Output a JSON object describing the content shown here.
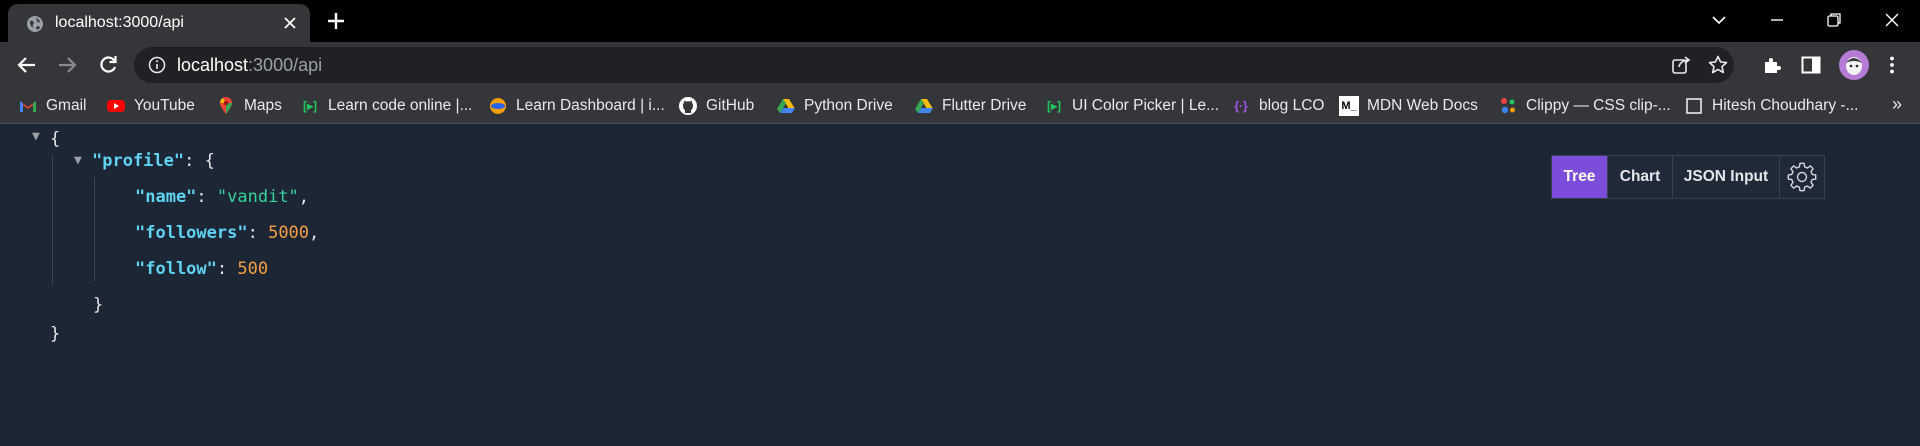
{
  "tab": {
    "title": "localhost:3000/api",
    "favicon": "globe-icon"
  },
  "address_bar": {
    "host": "localhost",
    "path": ":3000/api"
  },
  "bookmarks": [
    {
      "label": "Gmail",
      "icon": "gmail-icon"
    },
    {
      "label": "YouTube",
      "icon": "youtube-icon"
    },
    {
      "label": "Maps",
      "icon": "maps-pin-icon"
    },
    {
      "label": "Learn code online |...",
      "icon": "code-brackets-icon"
    },
    {
      "label": "Learn Dashboard | i...",
      "icon": "dashboard-icon"
    },
    {
      "label": "GitHub",
      "icon": "github-icon"
    },
    {
      "label": "Python Drive",
      "icon": "drive-icon"
    },
    {
      "label": "Flutter Drive",
      "icon": "drive-icon"
    },
    {
      "label": "UI Color Picker | Le...",
      "icon": "code-brackets-icon"
    },
    {
      "label": "blog LCO",
      "icon": "code-braces-icon"
    },
    {
      "label": "MDN Web Docs",
      "icon": "mdn-icon"
    },
    {
      "label": "Clippy — CSS clip-...",
      "icon": "clippy-icon"
    },
    {
      "label": "Hitesh Choudhary -...",
      "icon": "page-icon"
    }
  ],
  "bookmarks_overflow": "»",
  "json": {
    "open_brace": "{",
    "close_brace": "}",
    "profile_key": "\"profile\"",
    "profile_open": ": {",
    "profile_close": "}",
    "fields": [
      {
        "key": "\"name\"",
        "sep": ": ",
        "value": "\"vandit\"",
        "type": "string",
        "trail": ","
      },
      {
        "key": "\"followers\"",
        "sep": ": ",
        "value": "5000",
        "type": "number",
        "trail": ","
      },
      {
        "key": "\"follow\"",
        "sep": ": ",
        "value": "500",
        "type": "number",
        "trail": ""
      }
    ]
  },
  "view_modes": {
    "tree": "Tree",
    "chart": "Chart",
    "json_input": "JSON Input",
    "active": "Tree"
  },
  "colors": {
    "accent": "#7c4ddb",
    "key": "#5ed3f3",
    "string": "#34d399",
    "number": "#f59e42",
    "background": "#1d2634"
  }
}
